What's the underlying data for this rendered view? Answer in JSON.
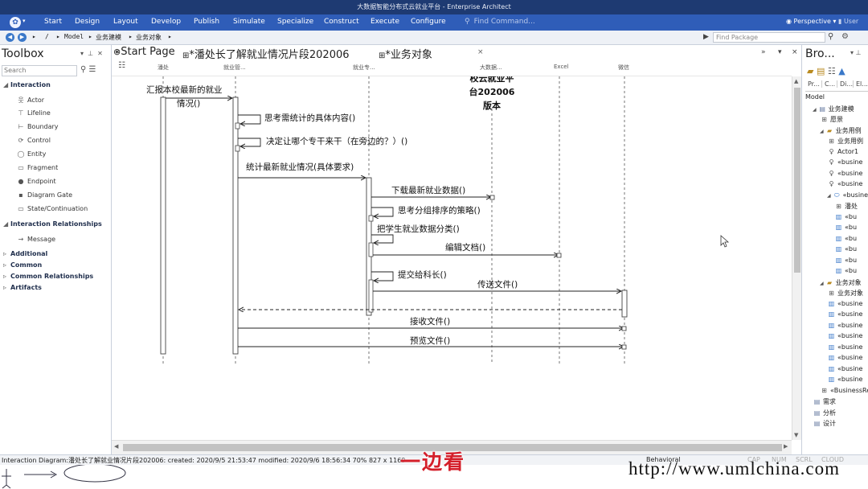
{
  "window": {
    "title": "大数据智能分布式云就业平台 - Enterprise Architect"
  },
  "ribbon": {
    "tabs": [
      "Start",
      "Design",
      "Layout",
      "Develop",
      "Publish",
      "Simulate",
      "Specialize",
      "Construct",
      "Execute",
      "Configure"
    ],
    "find_command": "Find Command...",
    "perspective": "Perspective",
    "user": "User"
  },
  "breadcrumb": {
    "items": [
      "/",
      "Model",
      "业务建模",
      "业务对象"
    ],
    "find_package_placeholder": "Find Package"
  },
  "toolbox": {
    "title": "Toolbox",
    "search_placeholder": "Search",
    "groups": {
      "interaction": "Interaction",
      "interaction_relationships": "Interaction Relationships",
      "additional": "Additional",
      "common": "Common",
      "common_relationships": "Common Relationships",
      "artifacts": "Artifacts"
    },
    "interaction_items": [
      "Actor",
      "Lifeline",
      "Boundary",
      "Control",
      "Entity",
      "Fragment",
      "Endpoint",
      "Diagram Gate",
      "State/Continuation"
    ],
    "relationship_items": [
      "Message"
    ]
  },
  "doc_tabs": {
    "start_page": "Start Page",
    "diagram": "*潘处长了解就业情况片段202006",
    "business_objects": "*业务对象"
  },
  "lifelines": {
    "headers": [
      "潘处",
      "就业管...",
      "就业专...",
      "大数据...",
      "Excel",
      "微信"
    ],
    "system_name_lines": [
      "校云就业平",
      "台202006",
      "版本"
    ]
  },
  "diagram": {
    "messages": [
      "汇报本校最新的就业",
      "情况()",
      "思考需统计的具体内容()",
      "决定让哪个专干来干（在旁边的？）()",
      "统计最新就业情况(具体要求)",
      "下载最新就业数据()",
      "思考分组排序的策略()",
      "把学生就业数据分类()",
      "编辑文档()",
      "提交给科长()",
      "传送文件()",
      "接收文件()",
      "预览文件()"
    ]
  },
  "browser": {
    "title": "Bro...",
    "tabs": [
      "Pr...",
      "C...",
      "Di...",
      "El..."
    ],
    "tree": [
      {
        "label": "Model",
        "indent": 0,
        "icon": ""
      },
      {
        "label": "业务建模",
        "indent": 1,
        "icon": "package"
      },
      {
        "label": "愿景",
        "indent": 2,
        "icon": "diagram"
      },
      {
        "label": "业务用例",
        "indent": 2,
        "icon": "folder"
      },
      {
        "label": "业务用例",
        "indent": 3,
        "icon": "diagram"
      },
      {
        "label": "Actor1",
        "indent": 3,
        "icon": "actor"
      },
      {
        "label": "«busine",
        "indent": 3,
        "icon": "actor"
      },
      {
        "label": "«busine",
        "indent": 3,
        "icon": "actor"
      },
      {
        "label": "«busine",
        "indent": 3,
        "icon": "actor"
      },
      {
        "label": "«busine",
        "indent": 3,
        "icon": "usecase"
      },
      {
        "label": "潘处",
        "indent": 4,
        "icon": "diagram"
      },
      {
        "label": "«bu",
        "indent": 4,
        "icon": "class"
      },
      {
        "label": "«bu",
        "indent": 4,
        "icon": "class"
      },
      {
        "label": "«bu",
        "indent": 4,
        "icon": "class"
      },
      {
        "label": "«bu",
        "indent": 4,
        "icon": "class"
      },
      {
        "label": "«bu",
        "indent": 4,
        "icon": "class"
      },
      {
        "label": "«bu",
        "indent": 4,
        "icon": "class"
      },
      {
        "label": "业务对象",
        "indent": 2,
        "icon": "folder"
      },
      {
        "label": "业务对象",
        "indent": 3,
        "icon": "diagram"
      },
      {
        "label": "«busine",
        "indent": 3,
        "icon": "class"
      },
      {
        "label": "«busine",
        "indent": 3,
        "icon": "class"
      },
      {
        "label": "«busine",
        "indent": 3,
        "icon": "class"
      },
      {
        "label": "«busine",
        "indent": 3,
        "icon": "class"
      },
      {
        "label": "«busine",
        "indent": 3,
        "icon": "class"
      },
      {
        "label": "«busine",
        "indent": 3,
        "icon": "class"
      },
      {
        "label": "«busine",
        "indent": 3,
        "icon": "class"
      },
      {
        "label": "«busine",
        "indent": 3,
        "icon": "class"
      },
      {
        "label": "«BusinessRe",
        "indent": 2,
        "icon": "diagram"
      },
      {
        "label": "需求",
        "indent": 1,
        "icon": "package"
      },
      {
        "label": "分析",
        "indent": 1,
        "icon": "package"
      },
      {
        "label": "设计",
        "indent": 1,
        "icon": "package"
      }
    ]
  },
  "status_bar": {
    "info": "Interaction Diagram:潘处长了解就业情况片段202006:   created: 2020/9/5 21:53:47  modified: 2020/9/6 18:56:34   70%   827 x 1169",
    "mode": "Behavioral",
    "indicators": [
      "CAP",
      "NUM",
      "SCRL",
      "CLOUD"
    ]
  },
  "overlay": {
    "subtitle": "一边看",
    "watermark": "http://www.umlchina.com"
  },
  "colors": {
    "ribbon": "#2f5db8",
    "title_bar": "#1e3a72",
    "subtitle": "#d41f2a"
  }
}
